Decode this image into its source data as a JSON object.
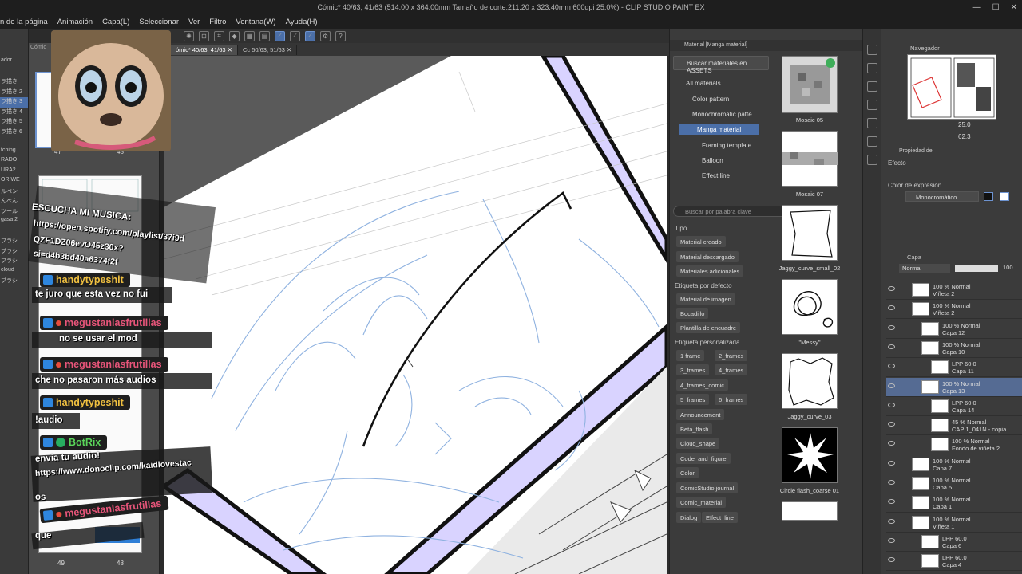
{
  "title_bar": {
    "title": "Cómic* 40/63, 41/63 (514.00 x 364.00mm Tamaño de corte:211.20 x 323.40mm 600dpi 25.0%) - CLIP STUDIO PAINT EX",
    "minimize": "—",
    "maximize": "☐",
    "close": "✕"
  },
  "menu": [
    "n de la página",
    "Animación",
    "Capa(L)",
    "Seleccionar",
    "Ver",
    "Filtro",
    "Ventana(W)",
    "Ayuda(H)"
  ],
  "left_strip": {
    "items": [
      "ador",
      "",
      "ラ描き",
      "ラ描き 2",
      "ラ描き 3",
      "ラ描き 4",
      "ラ描き 5",
      "ラ描き 6",
      "",
      "tching",
      "RADO",
      "URA2",
      "OR WE",
      "ルペン",
      "んぺん",
      "ツール",
      "gasa 2",
      "",
      "ブラシ",
      "ブラシ",
      "ブラシ",
      "cloud",
      "ブラシ"
    ]
  },
  "page_panel": {
    "tab": "Cómic",
    "numbers": {
      "p47": "47",
      "p48_top": "48",
      "p49": "49",
      "p48_bottom": "48"
    }
  },
  "canvas_tabs": [
    "ómic* 40/63, 41/63",
    "Cc 50/63, 51/63"
  ],
  "chat": {
    "header_line1": "ESCUCHA MI MUSICA:",
    "header_line2": "https://open.spotify.com/playlist/37i9d",
    "header_line3": "QZF1DZ06evO45z30x?",
    "header_line4": "si=d4b3bd40a6374f2f",
    "messages": [
      {
        "user": "handytypeshit",
        "color": "#f0c040",
        "text": "te juro que esta vez no fui"
      },
      {
        "user": "megustanlasfrutillas",
        "color": "#e8557a",
        "text": "no se usar el mod"
      },
      {
        "user": "megustanlasfrutillas",
        "color": "#e8557a",
        "text": "che no pasaron más audios"
      },
      {
        "user": "handytypeshit",
        "color": "#f0c040",
        "text": "!audio"
      },
      {
        "user": "BotRix",
        "color": "#5ad65a",
        "text": "envia tu audio!"
      },
      {
        "user": "",
        "color": "",
        "text": "https://www.donoclip.com/kaidlovestac"
      },
      {
        "user": "",
        "color": "",
        "text": "os"
      },
      {
        "user": "megustanlasfrutillas",
        "color": "#e8557a",
        "text": "que"
      }
    ]
  },
  "material_panel": {
    "header": "Material [Manga material]",
    "search_button": "Buscar materiales en ASSETS",
    "tree": [
      "All materials",
      "Color pattern",
      "Monochromatic patte",
      "Manga material",
      "Framing template",
      "Balloon",
      "Effect line"
    ],
    "keyword_placeholder": "Buscar por palabra clave",
    "tipo_header": "Tipo",
    "tipo_tags": [
      "Material creado",
      "Material descargado",
      "Materiales adicionales"
    ],
    "default_header": "Etiqueta por defecto",
    "default_tags": [
      "Material de imagen",
      "Bocadillo",
      "Plantilla de encuadre"
    ],
    "custom_header": "Etiqueta personalizada",
    "custom_tags": [
      "1 frame",
      "2_frames",
      "3_frames",
      "4_frames",
      "4_frames_comic",
      "5_frames",
      "6_frames",
      "Announcement",
      "Beta_flash",
      "Cloud_shape",
      "Code_and_figure",
      "Color",
      "ComicStudio journal",
      "Comic_material",
      "Dialog",
      "Effect_line"
    ],
    "thumbnails": [
      "Mosaic 05",
      "Mosaic 07",
      "Jaggy_curve_small_02",
      "\"Messy\"",
      "Jaggy_curve_03",
      "Circle flash_coarse 01"
    ]
  },
  "right_panel": {
    "navigator_title": "Navegador",
    "zoom": "25.0",
    "rotation": "62.3",
    "property_title": "Propiedad de",
    "effect_label": "Efecto",
    "expression_label": "Color de expresión",
    "expression_value": "Monocromático",
    "layer_tab": "Capa",
    "blend_mode": "Normal",
    "opacity": "100",
    "layers": [
      {
        "l1": "100 % Normal",
        "l2": "Viñeta 2",
        "indent": 0,
        "sel": false
      },
      {
        "l1": "100 % Normal",
        "l2": "Viñeta 2",
        "indent": 0,
        "sel": false
      },
      {
        "l1": "100 % Normal",
        "l2": "Capa 12",
        "indent": 1,
        "sel": false
      },
      {
        "l1": "100 % Normal",
        "l2": "Capa 10",
        "indent": 1,
        "sel": false
      },
      {
        "l1": "LPP 60.0",
        "l2": "Capa 11",
        "indent": 2,
        "sel": false
      },
      {
        "l1": "100 % Normal",
        "l2": "Capa 13",
        "indent": 1,
        "sel": true
      },
      {
        "l1": "LPP 60.0",
        "l2": "Capa 14",
        "indent": 2,
        "sel": false
      },
      {
        "l1": "45 % Normal",
        "l2": "CAP 1_041N - copia",
        "indent": 2,
        "sel": false
      },
      {
        "l1": "100 % Normal",
        "l2": "Fondo de viñeta 2",
        "indent": 2,
        "sel": false
      },
      {
        "l1": "100 % Normal",
        "l2": "Capa 7",
        "indent": 0,
        "sel": false
      },
      {
        "l1": "100 % Normal",
        "l2": "Capa 5",
        "indent": 0,
        "sel": false
      },
      {
        "l1": "100 % Normal",
        "l2": "Capa 1",
        "indent": 0,
        "sel": false
      },
      {
        "l1": "100 % Normal",
        "l2": "Viñeta 1",
        "indent": 0,
        "sel": false
      },
      {
        "l1": "LPP 60.0",
        "l2": "Capa 6",
        "indent": 1,
        "sel": false
      },
      {
        "l1": "LPP 60.0",
        "l2": "Capa 4",
        "indent": 1,
        "sel": false
      }
    ]
  }
}
